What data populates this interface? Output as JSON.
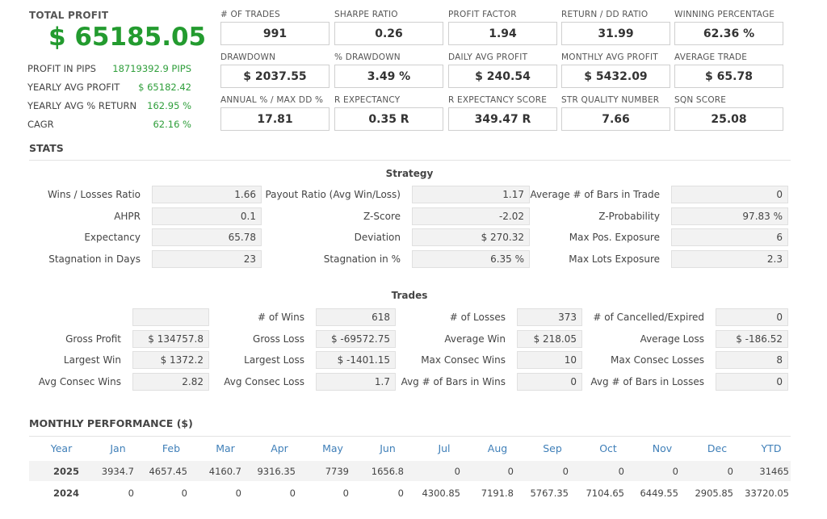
{
  "summary": {
    "total_profit_label": "TOTAL PROFIT",
    "total_profit_value": "$ 65185.05",
    "rows": [
      {
        "label": "PROFIT IN PIPS",
        "value": "18719392.9 PIPS"
      },
      {
        "label": "YEARLY AVG PROFIT",
        "value": "$ 65182.42"
      },
      {
        "label": "YEARLY AVG % RETURN",
        "value": "162.95 %"
      },
      {
        "label": "CAGR",
        "value": "62.16 %"
      }
    ]
  },
  "metrics": [
    {
      "label": "# OF TRADES",
      "value": "991"
    },
    {
      "label": "SHARPE RATIO",
      "value": "0.26"
    },
    {
      "label": "PROFIT FACTOR",
      "value": "1.94"
    },
    {
      "label": "RETURN / DD RATIO",
      "value": "31.99"
    },
    {
      "label": "WINNING PERCENTAGE",
      "value": "62.36 %"
    },
    {
      "label": "DRAWDOWN",
      "value": "$ 2037.55"
    },
    {
      "label": "% DRAWDOWN",
      "value": "3.49 %"
    },
    {
      "label": "DAILY AVG PROFIT",
      "value": "$ 240.54"
    },
    {
      "label": "MONTHLY AVG PROFIT",
      "value": "$ 5432.09"
    },
    {
      "label": "AVERAGE TRADE",
      "value": "$ 65.78"
    },
    {
      "label": "ANNUAL % / MAX DD %",
      "value": "17.81"
    },
    {
      "label": "R EXPECTANCY",
      "value": "0.35 R"
    },
    {
      "label": "R EXPECTANCY SCORE",
      "value": "349.47 R"
    },
    {
      "label": "STR QUALITY NUMBER",
      "value": "7.66"
    },
    {
      "label": "SQN SCORE",
      "value": "25.08"
    }
  ],
  "stats_title": "STATS",
  "strategy": {
    "title": "Strategy",
    "rows": [
      [
        {
          "label": "Wins / Losses Ratio",
          "value": "1.66"
        },
        {
          "label": "Payout Ratio (Avg Win/Loss)",
          "value": "1.17"
        },
        {
          "label": "Average # of Bars in Trade",
          "value": "0"
        }
      ],
      [
        {
          "label": "AHPR",
          "value": "0.1"
        },
        {
          "label": "Z-Score",
          "value": "-2.02"
        },
        {
          "label": "Z-Probability",
          "value": "97.83 %"
        }
      ],
      [
        {
          "label": "Expectancy",
          "value": "65.78"
        },
        {
          "label": "Deviation",
          "value": "$ 270.32"
        },
        {
          "label": "Max Pos. Exposure",
          "value": "6"
        }
      ],
      [
        {
          "label": "Stagnation in Days",
          "value": "23"
        },
        {
          "label": "Stagnation in %",
          "value": "6.35 %"
        },
        {
          "label": "Max Lots Exposure",
          "value": "2.3"
        }
      ]
    ]
  },
  "trades": {
    "title": "Trades",
    "rows": [
      [
        {
          "label": "",
          "value": ""
        },
        {
          "label": "# of Wins",
          "value": "618"
        },
        {
          "label": "# of Losses",
          "value": "373"
        },
        {
          "label": "# of Cancelled/Expired",
          "value": "0"
        }
      ],
      [
        {
          "label": "Gross Profit",
          "value": "$ 134757.8"
        },
        {
          "label": "Gross Loss",
          "value": "$ -69572.75"
        },
        {
          "label": "Average Win",
          "value": "$ 218.05"
        },
        {
          "label": "Average Loss",
          "value": "$ -186.52"
        }
      ],
      [
        {
          "label": "Largest Win",
          "value": "$ 1372.2"
        },
        {
          "label": "Largest Loss",
          "value": "$ -1401.15"
        },
        {
          "label": "Max Consec Wins",
          "value": "10"
        },
        {
          "label": "Max Consec Losses",
          "value": "8"
        }
      ],
      [
        {
          "label": "Avg Consec Wins",
          "value": "2.82"
        },
        {
          "label": "Avg Consec Loss",
          "value": "1.7"
        },
        {
          "label": "Avg # of Bars in Wins",
          "value": "0"
        },
        {
          "label": "Avg # of Bars in Losses",
          "value": "0"
        }
      ]
    ]
  },
  "monthly": {
    "title": "MONTHLY PERFORMANCE ($)",
    "headers": [
      "Year",
      "Jan",
      "Feb",
      "Mar",
      "Apr",
      "May",
      "Jun",
      "Jul",
      "Aug",
      "Sep",
      "Oct",
      "Nov",
      "Dec",
      "YTD"
    ],
    "rows": [
      [
        "2025",
        "3934.7",
        "4657.45",
        "4160.7",
        "9316.35",
        "7739",
        "1656.8",
        "0",
        "0",
        "0",
        "0",
        "0",
        "0",
        "31465"
      ],
      [
        "2024",
        "0",
        "0",
        "0",
        "0",
        "0",
        "0",
        "4300.85",
        "7191.8",
        "5767.35",
        "7104.65",
        "6449.55",
        "2905.85",
        "33720.05"
      ]
    ]
  }
}
